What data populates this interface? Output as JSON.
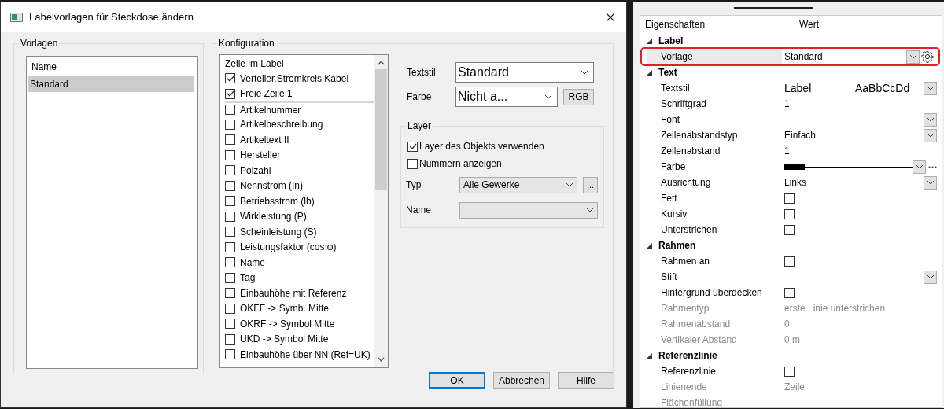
{
  "dialog": {
    "title": "Labelvorlagen für Steckdose ändern",
    "templates": {
      "title": "Vorlagen",
      "column": "Name",
      "rows": [
        {
          "name": "Standard",
          "selected": true
        }
      ]
    },
    "configuration": {
      "title": "Konfiguration",
      "column": "Zeile im Label",
      "lines": [
        {
          "label": "Verteiler.Stromkreis.Kabel",
          "checked": true
        },
        {
          "label": "Freie Zeile 1",
          "checked": true
        },
        {
          "label": "Artikelnummer",
          "checked": false
        },
        {
          "label": "Artikelbeschreibung",
          "checked": false
        },
        {
          "label": "Artikeltext II",
          "checked": false
        },
        {
          "label": "Hersteller",
          "checked": false
        },
        {
          "label": "Polzahl",
          "checked": false
        },
        {
          "label": "Nennstrom (In)",
          "checked": false
        },
        {
          "label": "Betriebsstrom (lb)",
          "checked": false
        },
        {
          "label": "Wirkleistung (P)",
          "checked": false
        },
        {
          "label": "Scheinleistung (S)",
          "checked": false
        },
        {
          "label": "Leistungsfaktor (cos φ)",
          "checked": false
        },
        {
          "label": "Name",
          "checked": false
        },
        {
          "label": "Tag",
          "checked": false
        },
        {
          "label": "Einbauhöhe mit Referenz",
          "checked": false
        },
        {
          "label": "OKFF -> Symb. Mitte",
          "checked": false
        },
        {
          "label": "OKRF -> Symbol Mitte",
          "checked": false
        },
        {
          "label": "UKD -> Symbol Mitte",
          "checked": false
        },
        {
          "label": "Einbauhöhe über NN (Ref=UK)",
          "checked": false
        }
      ],
      "textstyle": {
        "label": "Textstil",
        "value": "Standard"
      },
      "color": {
        "label": "Farbe",
        "value": "Nicht a...",
        "button": "RGB"
      },
      "layer": {
        "title": "Layer",
        "options": [
          {
            "label": "Layer des Objekts verwenden",
            "checked": true
          },
          {
            "label": "Nummern anzeigen",
            "checked": false
          }
        ],
        "type": {
          "label": "Typ",
          "value": "Alle Gewerke",
          "button": "..."
        },
        "name": {
          "label": "Name"
        }
      }
    },
    "buttons": [
      {
        "label": "OK",
        "default": true
      },
      {
        "label": "Abbrechen",
        "default": false
      },
      {
        "label": "Hilfe",
        "default": false
      }
    ]
  },
  "properties": {
    "columns": [
      "Eigenschaften",
      "Wert"
    ],
    "categories": [
      {
        "name": "Label",
        "expanded": true,
        "children": [
          {
            "name": "Vorlage",
            "kind": "dropdown",
            "value": "Standard",
            "highlighted": true,
            "settings": true
          }
        ]
      },
      {
        "name": "Text",
        "expanded": true,
        "children": [
          {
            "name": "Textstil",
            "kind": "style",
            "value": "Label",
            "sample": "AaBbCcDd"
          },
          {
            "name": "Schriftgrad",
            "kind": "text",
            "value": "1"
          },
          {
            "name": "Font",
            "kind": "dropdown"
          },
          {
            "name": "Zeilenabstandstyp",
            "kind": "dropdown",
            "value": "Einfach"
          },
          {
            "name": "Zeilenabstand",
            "kind": "text",
            "value": "1"
          },
          {
            "name": "Farbe",
            "kind": "color",
            "color": "#000000"
          },
          {
            "name": "Ausrichtung",
            "kind": "dropdown",
            "value": "Links"
          },
          {
            "name": "Fett",
            "kind": "checkbox",
            "checked": false
          },
          {
            "name": "Kursiv",
            "kind": "checkbox",
            "checked": false
          },
          {
            "name": "Unterstrichen",
            "kind": "checkbox",
            "checked": false
          }
        ]
      },
      {
        "name": "Rahmen",
        "expanded": true,
        "children": [
          {
            "name": "Rahmen an",
            "kind": "checkbox",
            "checked": false
          },
          {
            "name": "Stift",
            "kind": "dropdown"
          },
          {
            "name": "Hintergrund überdecken",
            "kind": "checkbox",
            "checked": false
          },
          {
            "name": "Rahmentyp",
            "kind": "text",
            "value": "erste Linie unterstrichen",
            "disabled": true
          },
          {
            "name": "Rahmenabstand",
            "kind": "text",
            "value": "0",
            "disabled": true
          },
          {
            "name": "Vertikaler Abstand",
            "kind": "text",
            "value": "0 m",
            "disabled": true
          }
        ]
      },
      {
        "name": "Referenzlinie",
        "expanded": true,
        "children": [
          {
            "name": "Referenzlinie",
            "kind": "checkbox",
            "checked": false
          },
          {
            "name": "Linienende",
            "kind": "text",
            "value": "Zeile",
            "disabled": true
          },
          {
            "name": "Flächenfüllung",
            "kind": "text",
            "disabled": true
          }
        ]
      }
    ]
  }
}
